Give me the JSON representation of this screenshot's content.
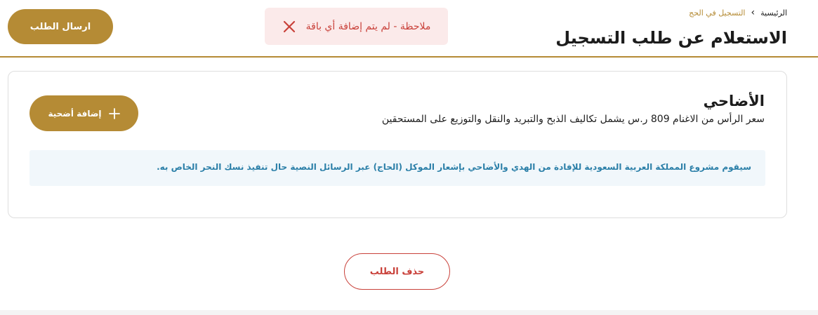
{
  "breadcrumb": {
    "home": "الرئيسية",
    "separator": "‹",
    "current": "التسجيل في الحج"
  },
  "header": {
    "title": "الاستعلام عن طلب التسجيل",
    "send_button": "ارسال الطلب"
  },
  "alert": {
    "text": "ملاحظة - لم يتم إضافة أي باقة",
    "close_icon": "close-icon"
  },
  "sacrifices": {
    "title": "الأضاحي",
    "description": "سعر الرأس من الاغنام 809 ر.س يشمل تكاليف الذبح والتبريد والنقل والتوزيع على المستحقين",
    "add_button": "إضافة أضحية",
    "add_icon": "plus-icon",
    "info": "سيقوم مشروع المملكة العربية السعودية للإفادة من الهدي والأضاحي بإشعار الموكل (الحاج) عبر الرسائل النصية حال تنفيذ نسك النحر الخاص به."
  },
  "actions": {
    "delete_button": "حذف الطلب"
  },
  "colors": {
    "gold": "#b58b35",
    "alert_red": "#c9413a",
    "alert_bg": "#fbeaea",
    "info_blue": "#2b7fa8",
    "info_bg": "#f1f7fb"
  }
}
